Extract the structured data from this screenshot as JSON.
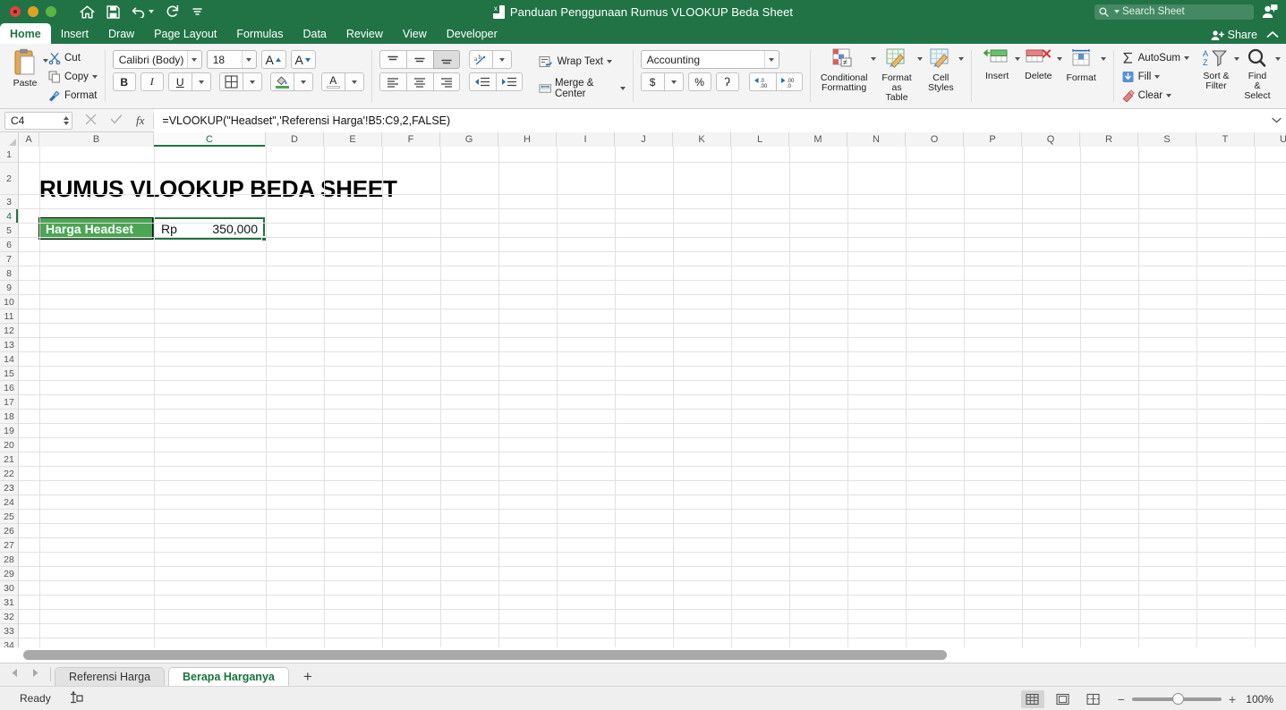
{
  "window": {
    "title": "Panduan Penggunaan Rumus VLOOKUP Beda Sheet",
    "doc_icon": "excel-document-icon",
    "traffic_lights": [
      "close",
      "minimize",
      "maximize"
    ]
  },
  "quick_access": [
    {
      "name": "home-icon",
      "label": "Home"
    },
    {
      "name": "save-icon",
      "label": "Save"
    },
    {
      "name": "undo-icon",
      "label": "Undo"
    },
    {
      "name": "redo-icon",
      "label": "Redo"
    },
    {
      "name": "customize-qat-icon",
      "label": "Customize Quick Access Toolbar"
    }
  ],
  "search": {
    "placeholder": "Search Sheet",
    "icon": "search-icon"
  },
  "account": {
    "person_icon": "person-icon",
    "share_label": "Share",
    "collapse_icon": "chevron-up-icon"
  },
  "ribbon": {
    "tabs": [
      {
        "label": "Home",
        "active": true
      },
      {
        "label": "Insert",
        "active": false
      },
      {
        "label": "Draw",
        "active": false
      },
      {
        "label": "Page Layout",
        "active": false
      },
      {
        "label": "Formulas",
        "active": false
      },
      {
        "label": "Data",
        "active": false
      },
      {
        "label": "Review",
        "active": false
      },
      {
        "label": "View",
        "active": false
      },
      {
        "label": "Developer",
        "active": false
      }
    ],
    "clipboard": {
      "paste_label": "Paste",
      "cut_label": "Cut",
      "copy_label": "Copy",
      "format_label": "Format"
    },
    "font": {
      "family_value": "Calibri (Body)",
      "size_value": "18",
      "grow_label": "A",
      "shrink_label": "A",
      "bold_label": "B",
      "italic_label": "I",
      "underline_label": "U",
      "borders_icon": "borders-icon",
      "fill_color_icon": "fill-color-icon",
      "font_color_label": "A"
    },
    "alignment": {
      "wrap_text_label": "Wrap Text",
      "merge_center_label": "Merge & Center",
      "orientation_icon": "orientation-icon",
      "indent_decrease_icon": "decrease-indent-icon",
      "indent_increase_icon": "increase-indent-icon"
    },
    "number": {
      "format_value": "Accounting",
      "currency_label": "$",
      "percent_label": "%",
      "comma_label": "`",
      "increase_decimal": ".00",
      "decrease_decimal": ".00"
    },
    "styles": {
      "conditional_formatting_label": "Conditional\nFormatting",
      "conditional_formatting_l1": "Conditional",
      "conditional_formatting_l2": "Formatting",
      "format_as_table_l1": "Format",
      "format_as_table_l2": "as Table",
      "cell_styles_l1": "Cell",
      "cell_styles_l2": "Styles"
    },
    "cells": {
      "insert_label": "Insert",
      "delete_label": "Delete",
      "format_label": "Format"
    },
    "editing": {
      "autosum_label": "AutoSum",
      "fill_label": "Fill",
      "clear_label": "Clear",
      "sort_filter_l1": "Sort &",
      "sort_filter_l2": "Filter",
      "find_select_l1": "Find &",
      "find_select_l2": "Select"
    }
  },
  "formula_bar": {
    "name_box_value": "C4",
    "cancel_icon": "cancel-icon",
    "enter_icon": "confirm-icon",
    "fx_label": "fx",
    "formula_value": "=VLOOKUP(\"Headset\",'Referensi Harga'!B5:C9,2,FALSE)",
    "expand_icon": "chevron-down-icon"
  },
  "grid": {
    "columns": [
      "A",
      "B",
      "C",
      "D",
      "E",
      "F",
      "G",
      "H",
      "I",
      "J",
      "K",
      "L",
      "M",
      "N",
      "O",
      "P",
      "Q",
      "R",
      "S",
      "T",
      "U"
    ],
    "selected_column": "C",
    "rows": [
      1,
      2,
      3,
      4,
      5,
      6,
      7,
      8,
      9,
      10,
      11,
      12,
      13,
      14,
      15,
      16,
      17,
      18,
      19,
      20,
      21,
      22,
      23,
      24,
      25,
      26,
      27,
      28,
      29,
      30,
      31,
      32,
      33,
      34
    ],
    "selected_row": 4,
    "cells": {
      "b2_title": "RUMUS VLOOKUP BEDA SHEET",
      "b4_label": "Harga Headset",
      "c4_currency": "Rp",
      "c4_amount": "350,000"
    },
    "selection_color": "#1f7044",
    "label_fill_color": "#4ba553"
  },
  "sheet_tabs": {
    "prev_icon": "previous-sheet-icon",
    "next_icon": "next-sheet-icon",
    "tabs": [
      {
        "label": "Referensi Harga",
        "active": false
      },
      {
        "label": "Berapa Harganya",
        "active": true
      }
    ],
    "add_label": "+"
  },
  "status_bar": {
    "status_text": "Ready",
    "selection_mode_icon": "selection-mode-icon",
    "views": [
      {
        "name": "normal-view",
        "active": true
      },
      {
        "name": "page-layout-view",
        "active": false
      },
      {
        "name": "page-break-view",
        "active": false
      }
    ],
    "zoom_out_label": "−",
    "zoom_in_label": "+",
    "zoom_value": "100%"
  },
  "theme": {
    "excel_green": "#217346",
    "accent_green": "#4ba553",
    "ribbon_bg": "#f4f4f4"
  }
}
